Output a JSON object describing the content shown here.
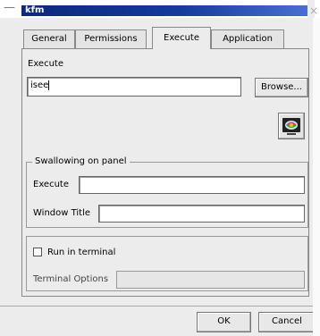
{
  "window": {
    "title": "kfm",
    "menu_glyph": "—",
    "close_glyph": "×"
  },
  "tabs": [
    {
      "label": "General",
      "active": false
    },
    {
      "label": "Permissions",
      "active": false
    },
    {
      "label": "Execute",
      "active": true
    },
    {
      "label": "Application",
      "active": false
    }
  ],
  "execute": {
    "label": "Execute",
    "command_value": "isee",
    "browse_label": "Browse..."
  },
  "icon_button": {
    "icon": "display-settings-icon"
  },
  "swallowing": {
    "title": "Swallowing on panel",
    "execute_label": "Execute",
    "execute_value": "",
    "window_title_label": "Window Title",
    "window_title_value": ""
  },
  "terminal": {
    "run_in_terminal_label": "Run in terminal",
    "run_in_terminal_checked": false,
    "options_label": "Terminal Options",
    "options_value": ""
  },
  "footer": {
    "ok_label": "OK",
    "cancel_label": "Cancel"
  },
  "colors": {
    "titlebar": "#153a9a",
    "background": "#ececec"
  }
}
